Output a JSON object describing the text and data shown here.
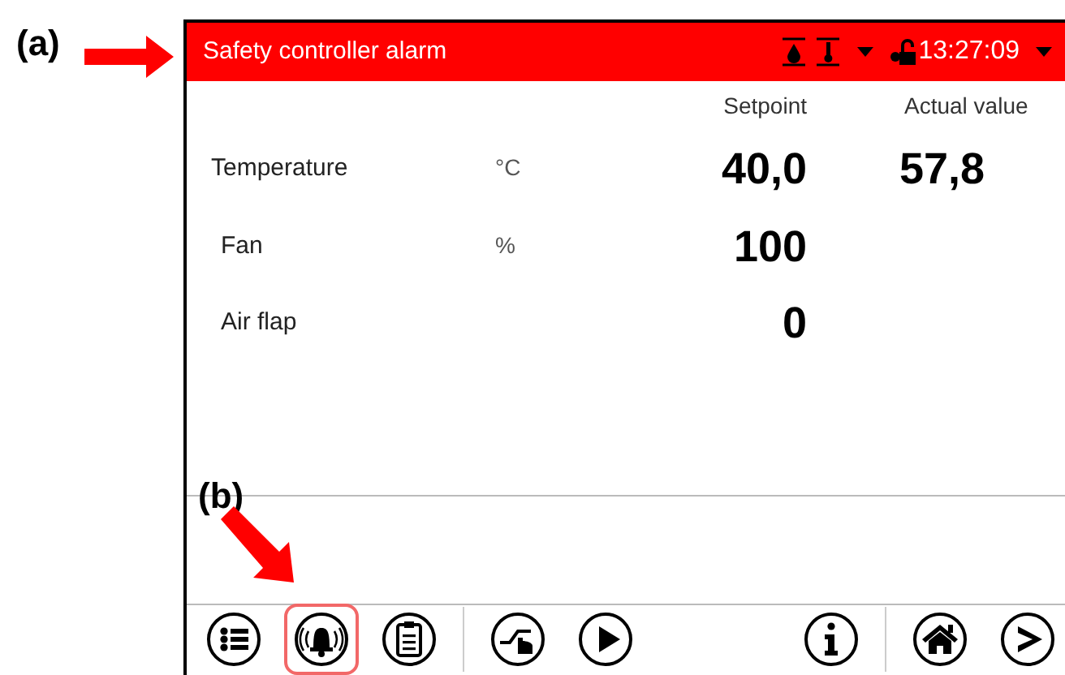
{
  "annotations": [
    {
      "label": "(a)"
    },
    {
      "label": "(b)"
    }
  ],
  "header": {
    "title": "Safety controller alarm",
    "time": "13:27:09"
  },
  "table": {
    "columns": [
      "Setpoint",
      "Actual value"
    ],
    "rows": [
      {
        "name": "Temperature",
        "unit": "°C",
        "setpoint": "40,0",
        "actual": "57,8"
      },
      {
        "name": "Fan",
        "unit": "%",
        "setpoint": "100"
      },
      {
        "name": "Air flap",
        "setpoint": "0"
      }
    ]
  },
  "toolbar": [
    {
      "kind": "menu",
      "selected": false
    },
    {
      "kind": "alarm",
      "selected": true
    },
    {
      "kind": "notes",
      "selected": false
    },
    {
      "kind": "divider"
    },
    {
      "kind": "manual",
      "selected": false
    },
    {
      "kind": "play",
      "selected": false
    },
    {
      "kind": "spacer"
    },
    {
      "kind": "info",
      "selected": false
    },
    {
      "kind": "divider"
    },
    {
      "kind": "home",
      "selected": false
    },
    {
      "kind": "next",
      "selected": false
    }
  ]
}
